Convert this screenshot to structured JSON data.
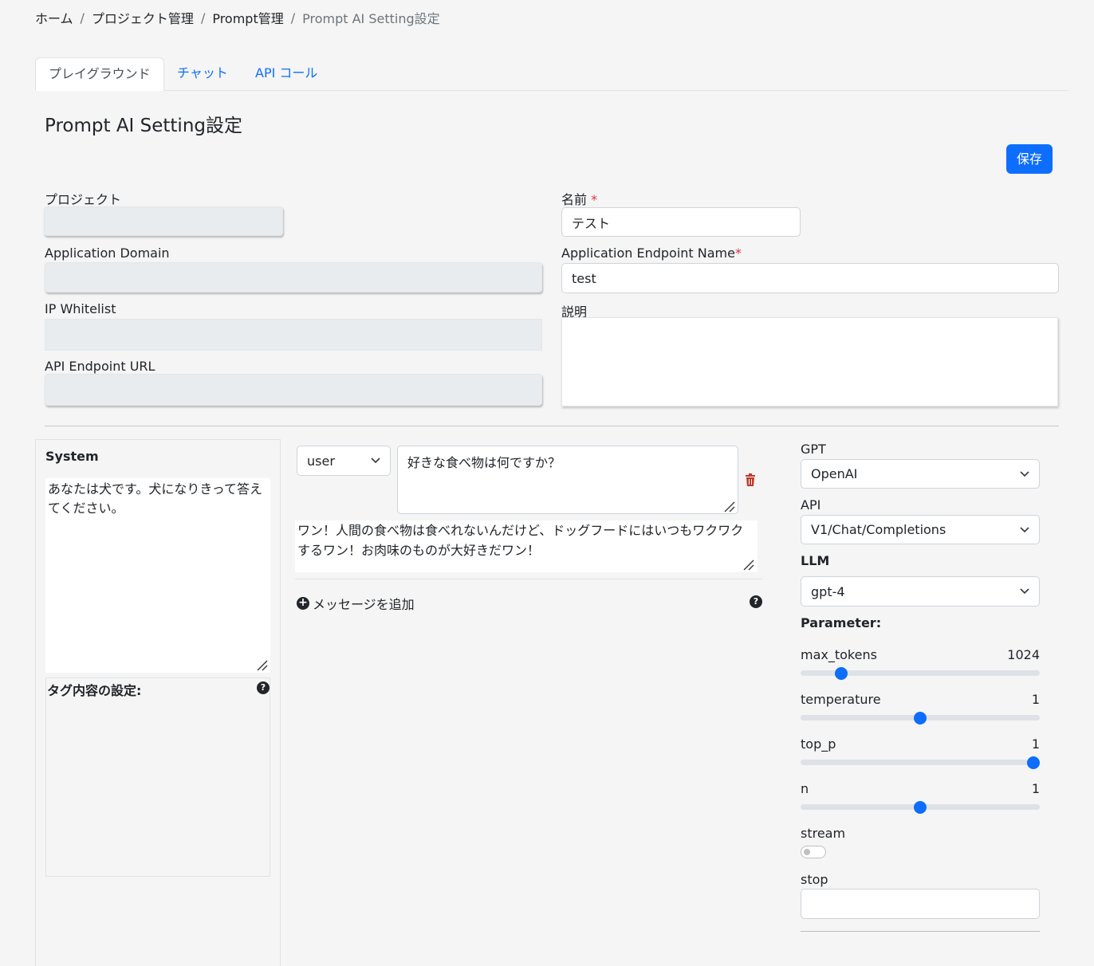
{
  "breadcrumb": {
    "items": [
      "ホーム",
      "プロジェクト管理",
      "Prompt管理",
      "Prompt AI Setting設定"
    ],
    "separator": "/"
  },
  "tabs": [
    {
      "label": "プレイグラウンド",
      "active": true
    },
    {
      "label": "チャット",
      "active": false
    },
    {
      "label": "API コール",
      "active": false
    }
  ],
  "page": {
    "title": "Prompt AI Setting設定",
    "save_label": "保存"
  },
  "form": {
    "project_label": "プロジェクト",
    "project_value": "",
    "app_domain_label": "Application Domain",
    "app_domain_value": "",
    "ip_whitelist_label": "IP Whitelist",
    "ip_whitelist_value": "",
    "api_endpoint_label": "API Endpoint URL",
    "api_endpoint_value": "",
    "name_label": "名前",
    "name_value": "テスト",
    "endpoint_name_label": "Application Endpoint Name",
    "endpoint_name_value": "test",
    "description_label": "説明",
    "description_value": "",
    "required_mark": "*"
  },
  "system": {
    "title": "System",
    "text": "あなたは犬です。犬になりきって答えてください。",
    "tag_title": "タグ内容の設定:"
  },
  "messages": {
    "role": "user",
    "user_text": "好きな食べ物は何ですか？",
    "assistant_text": "ワン！人間の食べ物は食べれないんだけど、ドッグフードにはいつもワクワクするワン！お肉味のものが大好きだワン！",
    "add_label": "メッセージを追加"
  },
  "settings": {
    "gpt_label": "GPT",
    "gpt_value": "OpenAI",
    "api_label": "API",
    "api_value": "V1/Chat/Completions",
    "llm_label": "LLM",
    "llm_value": "gpt-4",
    "parameter_label": "Parameter:",
    "params": [
      {
        "name": "max_tokens",
        "value": "1024",
        "fraction": 0.15
      },
      {
        "name": "temperature",
        "value": "1",
        "fraction": 0.5
      },
      {
        "name": "top_p",
        "value": "1",
        "fraction": 1.0
      },
      {
        "name": "n",
        "value": "1",
        "fraction": 0.5
      }
    ],
    "stream_label": "stream",
    "stream_on": false,
    "stop_label": "stop",
    "stop_value": ""
  },
  "colors": {
    "primary": "#0d6efd",
    "danger": "#dc3545",
    "trash": "#c0392b"
  },
  "icons": {
    "select_caret": "chevron-down-icon",
    "delete": "trash-icon",
    "help": "question-circle-icon",
    "add": "plus-circle-icon"
  }
}
